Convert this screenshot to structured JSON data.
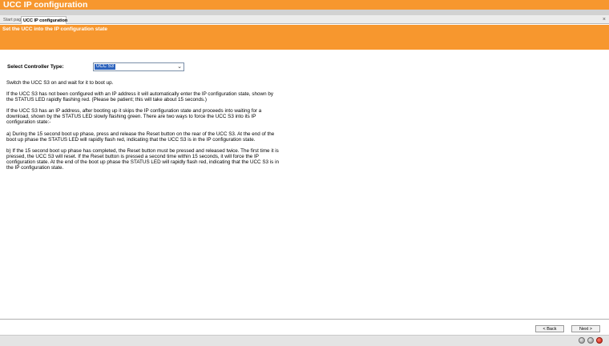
{
  "window": {
    "title": "UCC IP configuration"
  },
  "tabs": [
    {
      "label": "Start page"
    },
    {
      "label": "UCC IP configuration"
    }
  ],
  "tab_close": "×",
  "banner": {
    "title": "Set the UCC into the IP configuration state"
  },
  "controller": {
    "label": "Select Controller Type:",
    "selected": "UCC S3"
  },
  "instructions": [
    "Switch the UCC S3 on and wait for it to boot up.",
    "If the UCC S3 has not been configured with an IP address it will automatically enter the IP configuration state, shown by the STATUS LED rapidly flashing red.  (Please be patient; this will take about 15 seconds.)",
    "If the UCC S3 has an IP address, after booting up it skips the IP configuration state and proceeds into waiting for a download, shown by the STATUS LED slowly flashing green.  There are two ways to force the UCC S3 into its IP configuration state:-",
    "a) During the 15 second boot up phase, press and release the Reset button on the rear of the UCC S3.  At the end of the boot up phase the STATUS LED will rapidly flash red, indicating that the UCC S3 is in the IP configuration state.",
    "b) If the 15 second boot up phase has completed, the Reset button must be pressed and released twice.  The first time it is pressed, the UCC S3 will reset.  If the Reset button is pressed a second time within 15 seconds, it will force the IP configuration state.  At the end of the boot up phase the STATUS LED will rapidly flash red, indicating that the UCC S3 is in the IP configuration state."
  ],
  "buttons": {
    "back": "< Back",
    "next": "Next >"
  },
  "colors": {
    "accent": "#f7972e",
    "selection": "#2d63bd",
    "status_red": "#c81e10"
  }
}
